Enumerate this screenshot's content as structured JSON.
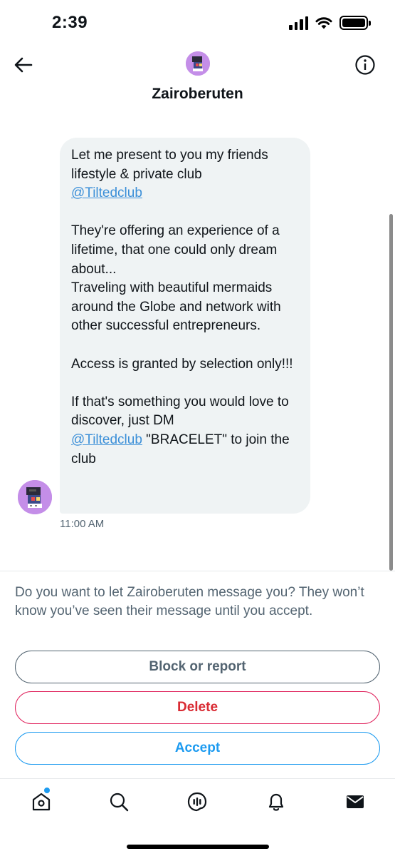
{
  "status_bar": {
    "time": "2:39"
  },
  "header": {
    "title": "Zairoberuten",
    "back_icon": "arrow-left-icon",
    "info_icon": "info-circle-icon"
  },
  "message": {
    "segments": [
      {
        "type": "text",
        "value": "Let me present to you my friends lifestyle & private club"
      },
      {
        "type": "mention",
        "value": "@Tiltedclub"
      },
      {
        "type": "gap"
      },
      {
        "type": "text",
        "value": "They're offering an experience of a lifetime, that one could only dream about...\nTraveling with beautiful mermaids around the Globe and network with other successful entrepreneurs."
      },
      {
        "type": "gap"
      },
      {
        "type": "text",
        "value": "Access is granted by selection only!!!"
      },
      {
        "type": "gap"
      },
      {
        "type": "text",
        "value": "If that's something you would love to discover, just DM"
      }
    ],
    "final_mention": "@Tiltedclub",
    "final_text": " \"BRACELET\" to join the club",
    "time": "11:00 AM"
  },
  "request": {
    "prompt": "Do you want to let Zairoberuten message you? They won’t know you’ve seen their message until you accept.",
    "block_label": "Block or report",
    "delete_label": "Delete",
    "accept_label": "Accept"
  },
  "tabbar": {
    "items": [
      "home-icon",
      "search-icon",
      "spaces-icon",
      "notifications-icon",
      "messages-icon"
    ]
  },
  "colors": {
    "accent": "#1d9bf0",
    "danger": "#d92b33",
    "secondary_text": "#536471",
    "bubble": "#eff3f4"
  }
}
